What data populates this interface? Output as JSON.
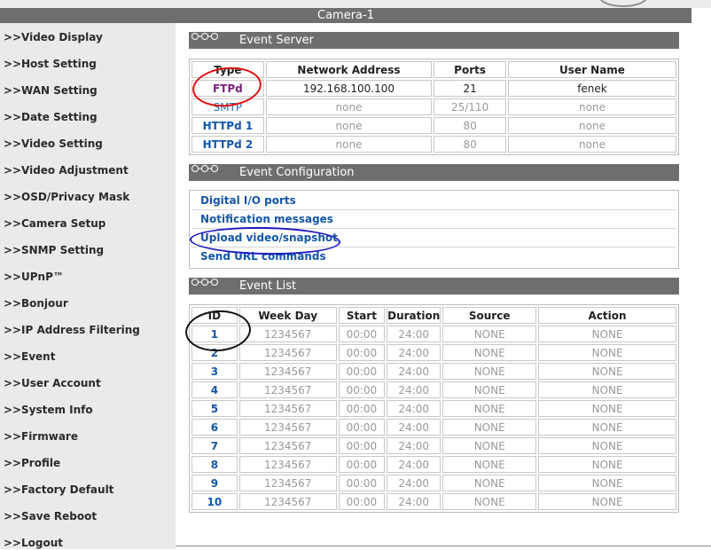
{
  "header": {
    "title": "Camera-1"
  },
  "sidebar": {
    "arrow_glyph": ">>",
    "items": [
      "Video Display",
      "Host Setting",
      "WAN Setting",
      "Date Setting",
      "Video Setting",
      "Video Adjustment",
      "OSD/Privacy Mask",
      "Camera Setup",
      "SNMP Setting",
      "UPnP™",
      "Bonjour",
      "IP Address Filtering",
      "Event",
      "User Account",
      "System Info",
      "Firmware",
      "Profile",
      "Factory Default",
      "Save Reboot",
      "Logout"
    ]
  },
  "event_server": {
    "title": "Event Server",
    "columns": [
      "Type",
      "Network Address",
      "Ports",
      "User Name"
    ],
    "rows": [
      {
        "type": "FTPd",
        "address": "192.168.100.100",
        "ports": "21",
        "user": "fenek"
      },
      {
        "type": "SMTP",
        "address": "none",
        "ports": "25/110",
        "user": "none"
      },
      {
        "type": "HTTPd 1",
        "address": "none",
        "ports": "80",
        "user": "none"
      },
      {
        "type": "HTTPd 2",
        "address": "none",
        "ports": "80",
        "user": "none"
      }
    ]
  },
  "event_configuration": {
    "title": "Event Configuration",
    "links": [
      "Digital I/O ports",
      "Notification messages",
      "Upload video/snapshot",
      "Send URL commands"
    ]
  },
  "event_list": {
    "title": "Event List",
    "columns": [
      "ID",
      "Week Day",
      "Start",
      "Duration",
      "Source",
      "Action"
    ],
    "rows": [
      {
        "id": "1",
        "weekday": "1234567",
        "start": "00:00",
        "duration": "24:00",
        "source": "NONE",
        "action": "NONE"
      },
      {
        "id": "2",
        "weekday": "1234567",
        "start": "00:00",
        "duration": "24:00",
        "source": "NONE",
        "action": "NONE"
      },
      {
        "id": "3",
        "weekday": "1234567",
        "start": "00:00",
        "duration": "24:00",
        "source": "NONE",
        "action": "NONE"
      },
      {
        "id": "4",
        "weekday": "1234567",
        "start": "00:00",
        "duration": "24:00",
        "source": "NONE",
        "action": "NONE"
      },
      {
        "id": "5",
        "weekday": "1234567",
        "start": "00:00",
        "duration": "24:00",
        "source": "NONE",
        "action": "NONE"
      },
      {
        "id": "6",
        "weekday": "1234567",
        "start": "00:00",
        "duration": "24:00",
        "source": "NONE",
        "action": "NONE"
      },
      {
        "id": "7",
        "weekday": "1234567",
        "start": "00:00",
        "duration": "24:00",
        "source": "NONE",
        "action": "NONE"
      },
      {
        "id": "8",
        "weekday": "1234567",
        "start": "00:00",
        "duration": "24:00",
        "source": "NONE",
        "action": "NONE"
      },
      {
        "id": "9",
        "weekday": "1234567",
        "start": "00:00",
        "duration": "24:00",
        "source": "NONE",
        "action": "NONE"
      },
      {
        "id": "10",
        "weekday": "1234567",
        "start": "00:00",
        "duration": "24:00",
        "source": "NONE",
        "action": "NONE"
      }
    ]
  },
  "annotations": {
    "red_circle": "#e01010",
    "blue_circle": "#1a1ac0",
    "black_circle": "#111111"
  },
  "colors": {
    "bar_gray": "#6e6e6e",
    "sidebar_bg": "#eaeaea",
    "link_blue": "#1357a8",
    "visited_purple": "#7a1f7a"
  }
}
